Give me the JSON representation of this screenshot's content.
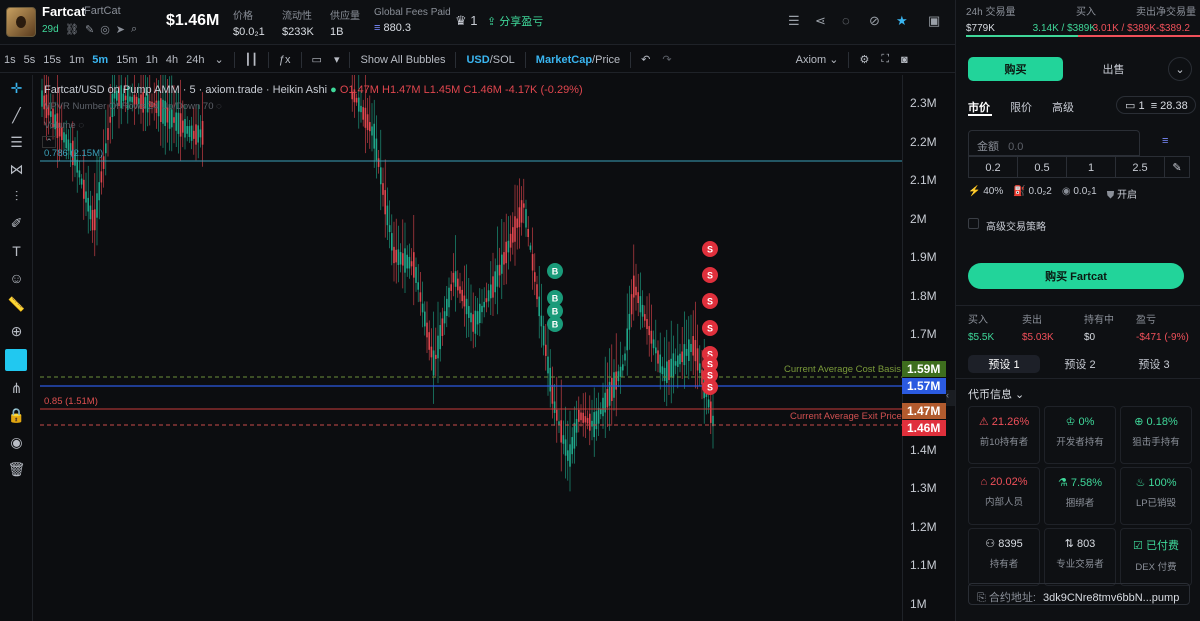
{
  "token": {
    "name": "Fartcat",
    "subname": "FartCat",
    "age": "29d",
    "price": "$1.46M"
  },
  "stats": [
    {
      "label": "价格",
      "value": "$0.0₂1"
    },
    {
      "label": "流动性",
      "value": "$233K"
    },
    {
      "label": "供应量",
      "value": "1B"
    },
    {
      "label": "Global Fees Paid",
      "value": "880.3"
    }
  ],
  "header": {
    "count": "1",
    "share": "分享盈亏"
  },
  "timeframes": [
    "1s",
    "5s",
    "15s",
    "1m",
    "5m",
    "15m",
    "1h",
    "4h",
    "24h"
  ],
  "active_tf": "5m",
  "toolbar": {
    "bubbles": "Show All Bubbles",
    "usd": "USD",
    "sol": "/SOL",
    "mcap": "MarketCap",
    "price": "/Price",
    "source": "Axiom"
  },
  "legend": {
    "title": "Fartcat/USD on Pump AMM · 5 · axiom.trade · Heikin Ashi",
    "o": "O1.47M",
    "h": "H1.47M",
    "l": "L1.45M",
    "c": "C1.46M",
    "chg": "-4.17K (-0.29%)",
    "vpvr": "VPVR Number Of Rows 24 Up/Down 70",
    "vol": "Volume"
  },
  "chart_lines": {
    "fib1": "0.786 (2.15M)",
    "fib2": "0.85 (1.51M)",
    "cost": "Current Average Cost Basis",
    "exit": "Current Average Exit Price"
  },
  "axis_ticks": [
    "2.3M",
    "2.2M",
    "2.1M",
    "2M",
    "1.9M",
    "1.8M",
    "1.7M",
    "1.6M",
    "1.5M",
    "1.4M",
    "1.3M",
    "1.2M",
    "1.1M",
    "1M"
  ],
  "axis_tags": [
    {
      "v": "1.59M",
      "color": "#3e6e1e"
    },
    {
      "v": "1.57M",
      "color": "#2b5ae0"
    },
    {
      "v": "1.47M",
      "color": "#b25b2e"
    },
    {
      "v": "1.46M",
      "color": "#e0303c"
    }
  ],
  "markers": {
    "buy": "B",
    "sell": "S"
  },
  "right": {
    "stats": [
      {
        "label": "24h 交易量",
        "value": "$779K",
        "color": "#d9dde3"
      },
      {
        "label": "买入",
        "value": "3.14K / $389K",
        "color": "#3fd89a"
      },
      {
        "label": "卖出",
        "value": "3.01K / $389K",
        "color": "#f0505a"
      },
      {
        "label": "净交易量",
        "value": "-$389.2",
        "color": "#f0505a"
      }
    ],
    "buy_tab": "购买",
    "sell_tab": "出售",
    "order_tabs": [
      "市价",
      "限价",
      "高级"
    ],
    "wallet": "1",
    "balance": "28.38",
    "amount_label": "金额",
    "amount_placeholder": "0.0",
    "presets": [
      "0.2",
      "0.5",
      "1",
      "2.5"
    ],
    "settings": [
      {
        "icon": "slippage",
        "v": "40%"
      },
      {
        "icon": "gas",
        "v": "0.0₂2"
      },
      {
        "icon": "tip",
        "v": "0.0₂1"
      },
      {
        "icon": "shield",
        "v": "开启"
      }
    ],
    "advanced": "高级交易策略",
    "buy_button": "购买 Fartcat",
    "pos": [
      {
        "label": "买入",
        "value": "$5.5K",
        "color": "#3fd89a"
      },
      {
        "label": "卖出",
        "value": "$5.03K",
        "color": "#f0505a"
      },
      {
        "label": "持有中",
        "value": "$0",
        "color": "#d9dde3"
      },
      {
        "label": "盈亏",
        "value": "-$471 (-9%)",
        "color": "#f0505a"
      }
    ],
    "preset_tabs": [
      "预设 1",
      "预设 2",
      "预设 3"
    ],
    "info_title": "代币信息",
    "info": [
      {
        "v": "21.26%",
        "l": "前10持有者",
        "c": "#f0505a"
      },
      {
        "v": "0%",
        "l": "开发者持有",
        "c": "#3fd89a"
      },
      {
        "v": "0.18%",
        "l": "狙击手持有",
        "c": "#3fd89a"
      },
      {
        "v": "20.02%",
        "l": "内部人员",
        "c": "#f0505a"
      },
      {
        "v": "7.58%",
        "l": "捆绑者",
        "c": "#3fd89a"
      },
      {
        "v": "100%",
        "l": "LP已销毁",
        "c": "#3fd89a"
      },
      {
        "v": "8395",
        "l": "持有者",
        "c": "#d9dde3"
      },
      {
        "v": "803",
        "l": "专业交易者",
        "c": "#d9dde3"
      },
      {
        "v": "已付费",
        "l": "DEX 付费",
        "c": "#3fd89a"
      }
    ],
    "ca_label": "合约地址:",
    "ca": "3dk9CNre8tmv6bbN...pump"
  }
}
